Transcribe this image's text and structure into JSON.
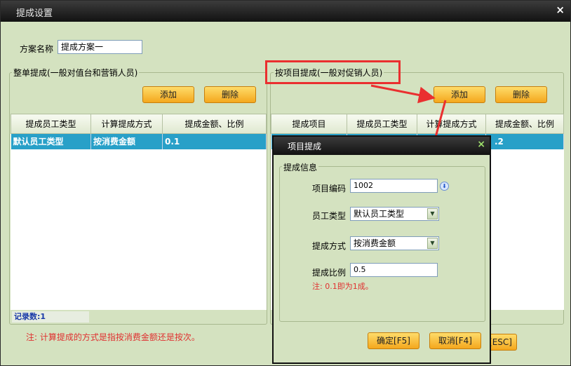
{
  "window": {
    "title": "提成设置",
    "close": "×"
  },
  "plan": {
    "label": "方案名称",
    "value": "提成方案一"
  },
  "left_group": {
    "legend": "整单提成(一般对值台和营销人员)",
    "add": "添加",
    "delete": "删除",
    "headers": [
      "提成员工类型",
      "计算提成方式",
      "提成金额、比例"
    ],
    "rows": [
      [
        "默认员工类型",
        "按消费金额",
        "0.1"
      ]
    ],
    "record": "记录数:1"
  },
  "right_group": {
    "legend": "按项目提成(一般对促销人员)",
    "add": "添加",
    "delete": "删除",
    "headers": [
      "提成项目",
      "提成员工类型",
      "计算提成方式",
      "提成金额、比例"
    ],
    "row_tail": ".2"
  },
  "bottom_note": "注: 计算提成的方式是指按消费金额还是按次。",
  "esc_partial": "[ESC]",
  "dialog": {
    "title": "项目提成",
    "close": "×",
    "group": "提成信息",
    "code_label": "项目编码",
    "code_value": "1002",
    "emp_label": "员工类型",
    "emp_value": "默认员工类型",
    "method_label": "提成方式",
    "method_value": "按消费金额",
    "ratio_label": "提成比例",
    "ratio_value": "0.5",
    "note": "注: 0.1即为1成。",
    "ok": "确定[F5]",
    "cancel": "取消[F4]"
  },
  "colors": {
    "annotation": "#ea2f2f",
    "selected_row": "#28a0c8",
    "button": "#f4a71d"
  }
}
